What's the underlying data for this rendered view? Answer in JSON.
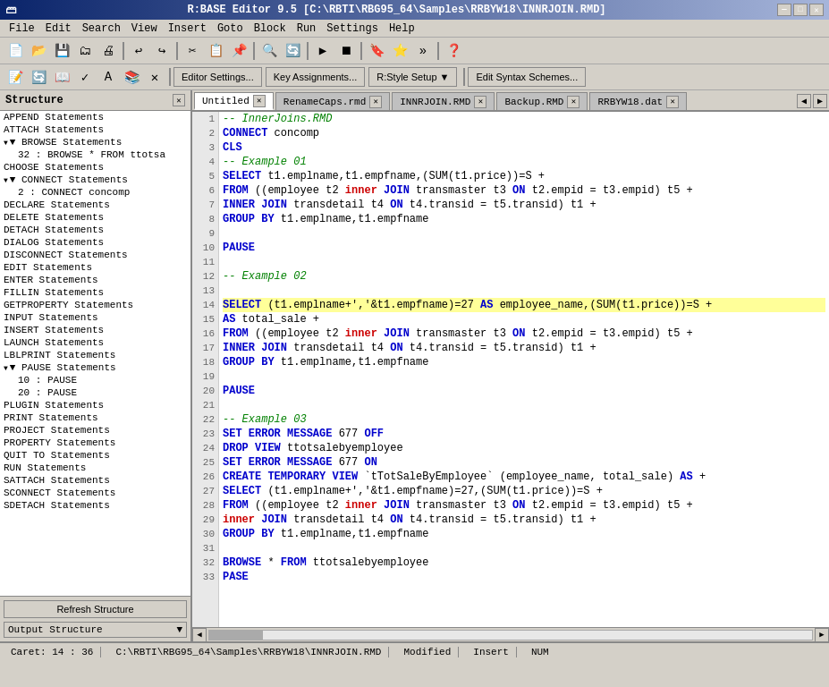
{
  "title_bar": {
    "title": "R:BASE Editor 9.5 [C:\\RBTI\\RBG95_64\\Samples\\RRBYW18\\INNRJOIN.RMD]",
    "min_btn": "—",
    "max_btn": "□",
    "close_btn": "✕"
  },
  "menu": {
    "items": [
      "File",
      "Edit",
      "Search",
      "View",
      "Insert",
      "Goto",
      "Block",
      "Run",
      "Settings",
      "Help"
    ]
  },
  "toolbar2": {
    "btn1": "Editor Settings...",
    "btn2": "Key Assignments...",
    "btn3": "R:Style Setup ▼",
    "btn4": "Edit Syntax Schemes..."
  },
  "structure": {
    "header": "Structure",
    "items": [
      {
        "label": "APPEND Statements",
        "type": "parent",
        "indent": 0
      },
      {
        "label": "ATTACH Statements",
        "type": "parent",
        "indent": 0
      },
      {
        "label": "BROWSE Statements",
        "type": "expanded",
        "indent": 0
      },
      {
        "label": "32 : BROWSE * FROM ttotsa",
        "type": "child",
        "indent": 1
      },
      {
        "label": "CHOOSE Statements",
        "type": "parent",
        "indent": 0
      },
      {
        "label": "CONNECT Statements",
        "type": "expanded",
        "indent": 0
      },
      {
        "label": "2 : CONNECT concomp",
        "type": "child",
        "indent": 1
      },
      {
        "label": "DECLARE Statements",
        "type": "parent",
        "indent": 0
      },
      {
        "label": "DELETE Statements",
        "type": "parent",
        "indent": 0
      },
      {
        "label": "DETACH Statements",
        "type": "parent",
        "indent": 0
      },
      {
        "label": "DIALOG Statements",
        "type": "parent",
        "indent": 0
      },
      {
        "label": "DISCONNECT Statements",
        "type": "parent",
        "indent": 0
      },
      {
        "label": "EDIT Statements",
        "type": "parent",
        "indent": 0
      },
      {
        "label": "ENTER Statements",
        "type": "parent",
        "indent": 0
      },
      {
        "label": "FILLIN Statements",
        "type": "parent",
        "indent": 0
      },
      {
        "label": "GETPROPERTY Statements",
        "type": "parent",
        "indent": 0
      },
      {
        "label": "INPUT Statements",
        "type": "parent",
        "indent": 0
      },
      {
        "label": "INSERT Statements",
        "type": "parent",
        "indent": 0
      },
      {
        "label": "LAUNCH Statements",
        "type": "parent",
        "indent": 0
      },
      {
        "label": "LBLPRINT Statements",
        "type": "parent",
        "indent": 0
      },
      {
        "label": "PAUSE Statements",
        "type": "expanded",
        "indent": 0
      },
      {
        "label": "10 : PAUSE",
        "type": "child",
        "indent": 1
      },
      {
        "label": "20 : PAUSE",
        "type": "child",
        "indent": 1
      },
      {
        "label": "PLUGIN Statements",
        "type": "parent",
        "indent": 0
      },
      {
        "label": "PRINT Statements",
        "type": "parent",
        "indent": 0
      },
      {
        "label": "PROJECT Statements",
        "type": "parent",
        "indent": 0
      },
      {
        "label": "PROPERTY Statements",
        "type": "parent",
        "indent": 0
      },
      {
        "label": "QUIT TO Statements",
        "type": "parent",
        "indent": 0
      },
      {
        "label": "RUN Statements",
        "type": "parent",
        "indent": 0
      },
      {
        "label": "SATTACH Statements",
        "type": "parent",
        "indent": 0
      },
      {
        "label": "SCONNECT Statements",
        "type": "parent",
        "indent": 0
      },
      {
        "label": "SDETACH Statements",
        "type": "parent",
        "indent": 0
      }
    ],
    "refresh_btn": "Refresh Structure",
    "output_dropdown": "Output Structure"
  },
  "tabs": [
    {
      "label": "Untitled",
      "active": true,
      "closeable": true
    },
    {
      "label": "RenameCaps.rmd",
      "active": false,
      "closeable": true
    },
    {
      "label": "INNRJOIN.RMD",
      "active": false,
      "closeable": true
    },
    {
      "label": "Backup.RMD",
      "active": false,
      "closeable": true
    },
    {
      "label": "RRBYW18.dat",
      "active": false,
      "closeable": true
    }
  ],
  "code_lines": [
    {
      "num": 1,
      "text": "-- InnerJoins.RMD",
      "highlight": false
    },
    {
      "num": 2,
      "text": "CONNECT concomp",
      "highlight": false
    },
    {
      "num": 3,
      "text": "CLS",
      "highlight": false
    },
    {
      "num": 4,
      "text": "-- Example 01",
      "highlight": false
    },
    {
      "num": 5,
      "text": "SELECT t1.emplname,t1.empfname,(SUM(t1.price))=S +",
      "highlight": false
    },
    {
      "num": 6,
      "text": "FROM ((employee t2 inner JOIN transmaster t3 ON t2.empid = t3.empid) t5 +",
      "highlight": false
    },
    {
      "num": 7,
      "text": "INNER JOIN transdetail t4 ON t4.transid = t5.transid) t1 +",
      "highlight": false
    },
    {
      "num": 8,
      "text": "GROUP BY t1.emplname,t1.empfname",
      "highlight": false
    },
    {
      "num": 9,
      "text": "",
      "highlight": false
    },
    {
      "num": 10,
      "text": "PAUSE",
      "highlight": false
    },
    {
      "num": 11,
      "text": "",
      "highlight": false
    },
    {
      "num": 12,
      "text": "-- Example 02",
      "highlight": false
    },
    {
      "num": 13,
      "text": "",
      "highlight": false
    },
    {
      "num": 14,
      "text": "SELECT (t1.emplname+','&t1.empfname)=27 AS employee_name,(SUM(t1.price))=S +",
      "highlight": true
    },
    {
      "num": 15,
      "text": "AS total_sale +",
      "highlight": false
    },
    {
      "num": 16,
      "text": "FROM ((employee t2 inner JOIN transmaster t3 ON t2.empid = t3.empid) t5 +",
      "highlight": false
    },
    {
      "num": 17,
      "text": "INNER JOIN transdetail t4 ON t4.transid = t5.transid) t1 +",
      "highlight": false
    },
    {
      "num": 18,
      "text": "GROUP BY t1.emplname,t1.empfname",
      "highlight": false
    },
    {
      "num": 19,
      "text": "",
      "highlight": false
    },
    {
      "num": 20,
      "text": "PAUSE",
      "highlight": false
    },
    {
      "num": 21,
      "text": "",
      "highlight": false
    },
    {
      "num": 22,
      "text": "-- Example 03",
      "highlight": false
    },
    {
      "num": 23,
      "text": "SET ERROR MESSAGE 677 OFF",
      "highlight": false
    },
    {
      "num": 24,
      "text": "DROP VIEW ttotsalebyemployee",
      "highlight": false
    },
    {
      "num": 25,
      "text": "SET ERROR MESSAGE 677 ON",
      "highlight": false
    },
    {
      "num": 26,
      "text": "CREATE TEMPORARY VIEW `tTotSaleByEmployee` (employee_name, total_sale) AS +",
      "highlight": false
    },
    {
      "num": 27,
      "text": "SELECT (t1.emplname+','&t1.empfname)=27,(SUM(t1.price))=S +",
      "highlight": false
    },
    {
      "num": 28,
      "text": "FROM ((employee t2 inner JOIN transmaster t3 ON t2.empid = t3.empid) t5 +",
      "highlight": false
    },
    {
      "num": 29,
      "text": "inner JOIN transdetail t4 ON t4.transid = t5.transid) t1 +",
      "highlight": false
    },
    {
      "num": 30,
      "text": "GROUP BY t1.emplname,t1.empfname",
      "highlight": false
    },
    {
      "num": 31,
      "text": "",
      "highlight": false
    },
    {
      "num": 32,
      "text": "BROWSE * FROM ttotsalebyemployee",
      "highlight": false
    },
    {
      "num": 33,
      "text": "PASE",
      "highlight": false
    }
  ],
  "status_bar": {
    "caret": "Caret: 14 : 36",
    "path": "C:\\RBTI\\RBG95_64\\Samples\\RRBYW18\\INNRJOIN.RMD",
    "modified": "Modified",
    "insert": "Insert",
    "num": "NUM"
  }
}
